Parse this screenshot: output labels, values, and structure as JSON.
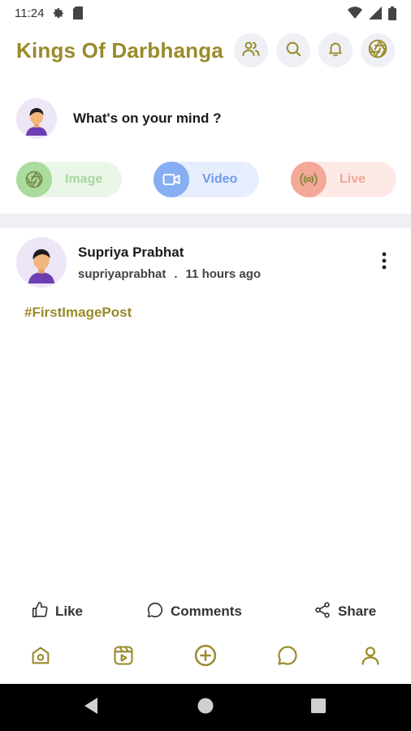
{
  "status_bar": {
    "time": "11:24"
  },
  "header": {
    "title": "Kings Of Darbhanga"
  },
  "composer": {
    "prompt": "What's on your mind ?"
  },
  "actions": {
    "image_label": "Image",
    "video_label": "Video",
    "live_label": "Live"
  },
  "post": {
    "author": "Supriya Prabhat",
    "username": "supriyaprabhat",
    "separator": ".",
    "time": "11 hours ago",
    "hashtag": "#FirstImagePost"
  },
  "reactions": {
    "like_label": "Like",
    "comments_label": "Comments",
    "share_label": "Share"
  },
  "colors": {
    "brand": "#9a8a2a",
    "image_accent": "#a9dc9d",
    "video_accent": "#86aef3",
    "live_accent": "#f4a898"
  },
  "icons": {
    "header": [
      "users-icon",
      "search-icon",
      "bell-icon",
      "aperture-icon"
    ],
    "nav": [
      "home-icon",
      "reels-icon",
      "add-icon",
      "chat-icon",
      "profile-icon"
    ]
  }
}
